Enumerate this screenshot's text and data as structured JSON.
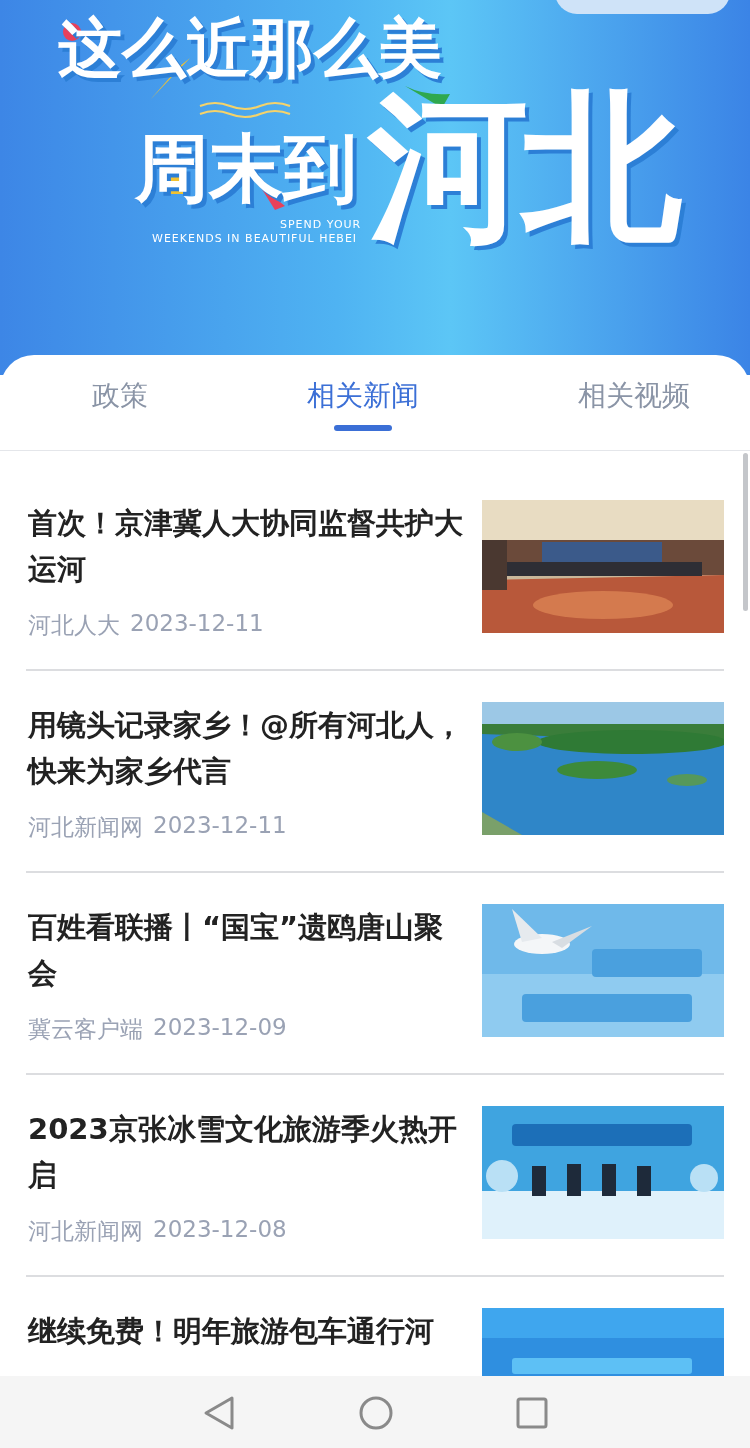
{
  "banner": {
    "headline_1": "这么近那么美",
    "headline_2": "周末到",
    "headline_3": "河北",
    "tagline_1": "SPEND YOUR",
    "tagline_2": "WEEKENDS IN BEAUTIFUL HEBEI"
  },
  "tabs": [
    {
      "label": "政策",
      "selected": false
    },
    {
      "label": "相关新闻",
      "selected": true
    },
    {
      "label": "相关视频",
      "selected": false
    }
  ],
  "news": [
    {
      "title": "首次！京津冀人大协同监督共护大运河",
      "source": "河北人大",
      "date": "2023-12-11"
    },
    {
      "title": "用镜头记录家乡！@所有河北人，快来为家乡代言",
      "source": "河北新闻网",
      "date": "2023-12-11"
    },
    {
      "title": "百姓看联播丨“国宝”遗鸥唐山聚会",
      "source": "冀云客户端",
      "date": "2023-12-09"
    },
    {
      "title": "2023京张冰雪文化旅游季火热开启",
      "source": "河北新闻网",
      "date": "2023-12-08"
    },
    {
      "title": "继续免费！明年旅游包车通行河"
    }
  ]
}
